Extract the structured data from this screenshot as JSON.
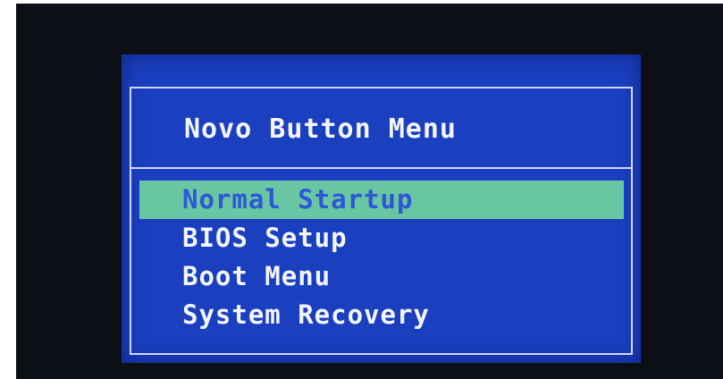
{
  "bios_menu": {
    "title": "Novo Button Menu",
    "items": [
      {
        "label": "Normal Startup",
        "selected": true
      },
      {
        "label": "BIOS Setup",
        "selected": false
      },
      {
        "label": "Boot Menu",
        "selected": false
      },
      {
        "label": "System Recovery",
        "selected": false
      }
    ]
  },
  "colors": {
    "background": "#0d0f17",
    "panel": "#1a3fbf",
    "border": "#cfd6ff",
    "text": "#f4f6ff",
    "highlight": "#69c6a3",
    "highlight_text": "#2f56d6"
  }
}
